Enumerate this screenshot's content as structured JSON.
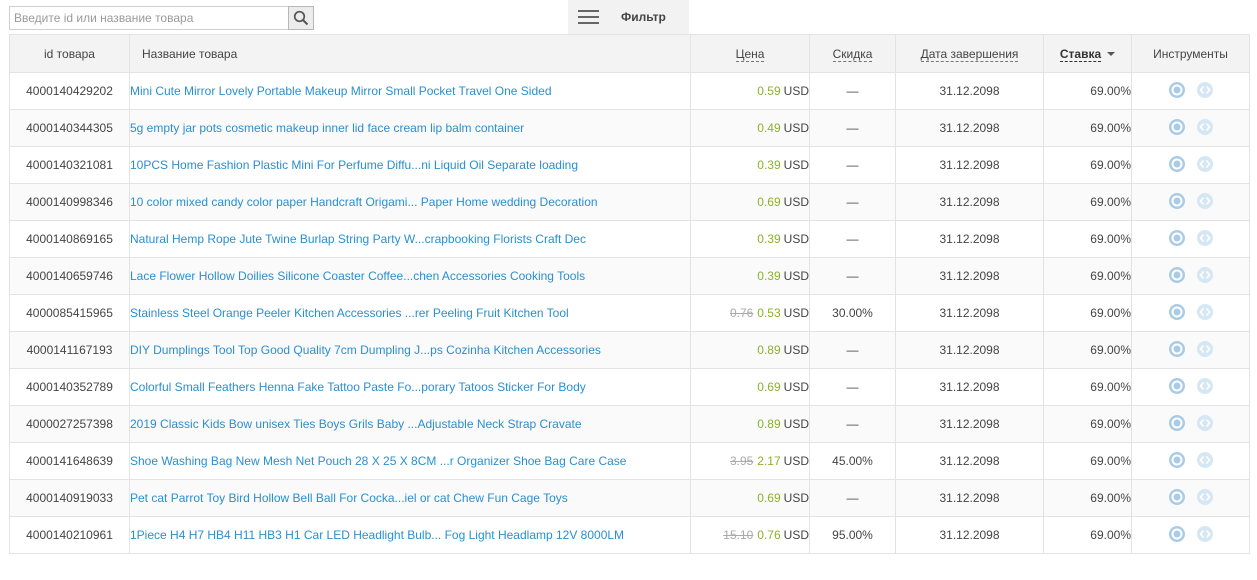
{
  "search": {
    "placeholder": "Введите id или название товара",
    "value": "",
    "icon": "search-icon"
  },
  "filter": {
    "label": "Фильтр",
    "icon": "hamburger-icon"
  },
  "table": {
    "headers": {
      "id": "id товара",
      "name": "Название товара",
      "price": "Цена",
      "discount": "Скидка",
      "end_date": "Дата завершения",
      "rate": "Ставка",
      "tools": "Инструменты"
    },
    "sorted_by": "rate",
    "sort_direction": "desc",
    "rows": [
      {
        "id": "4000140429202",
        "name": "Mini Cute Mirror Lovely Portable Makeup Mirror Small Pocket Travel One Sided",
        "old_price": "",
        "price": "0.59",
        "currency": "USD",
        "discount": "—",
        "end_date": "31.12.2098",
        "rate": "69.00%"
      },
      {
        "id": "4000140344305",
        "name": "5g empty jar pots cosmetic makeup inner lid face cream lip balm container",
        "old_price": "",
        "price": "0.49",
        "currency": "USD",
        "discount": "—",
        "end_date": "31.12.2098",
        "rate": "69.00%"
      },
      {
        "id": "4000140321081",
        "name": "10PCS Home Fashion Plastic Mini For Perfume Diffu...ni Liquid Oil Separate loading",
        "old_price": "",
        "price": "0.39",
        "currency": "USD",
        "discount": "—",
        "end_date": "31.12.2098",
        "rate": "69.00%"
      },
      {
        "id": "4000140998346",
        "name": "10 color mixed candy color paper Handcraft Origami... Paper Home wedding Decoration",
        "old_price": "",
        "price": "0.69",
        "currency": "USD",
        "discount": "—",
        "end_date": "31.12.2098",
        "rate": "69.00%"
      },
      {
        "id": "4000140869165",
        "name": "Natural Hemp Rope Jute Twine Burlap String Party W...crapbooking Florists Craft Dec",
        "old_price": "",
        "price": "0.39",
        "currency": "USD",
        "discount": "—",
        "end_date": "31.12.2098",
        "rate": "69.00%"
      },
      {
        "id": "4000140659746",
        "name": "Lace Flower Hollow Doilies Silicone Coaster Coffee...chen Accessories Cooking Tools",
        "old_price": "",
        "price": "0.39",
        "currency": "USD",
        "discount": "—",
        "end_date": "31.12.2098",
        "rate": "69.00%"
      },
      {
        "id": "4000085415965",
        "name": "Stainless Steel Orange Peeler Kitchen Accessories ...rer Peeling Fruit Kitchen Tool",
        "old_price": "0.76",
        "price": "0.53",
        "currency": "USD",
        "discount": "30.00%",
        "end_date": "31.12.2098",
        "rate": "69.00%"
      },
      {
        "id": "4000141167193",
        "name": "DIY Dumplings Tool Top Good Quality 7cm Dumpling J...ps Cozinha Kitchen Accessories",
        "old_price": "",
        "price": "0.89",
        "currency": "USD",
        "discount": "—",
        "end_date": "31.12.2098",
        "rate": "69.00%"
      },
      {
        "id": "4000140352789",
        "name": "Colorful Small Feathers Henna Fake Tattoo Paste Fo...porary Tatoos Sticker For Body",
        "old_price": "",
        "price": "0.69",
        "currency": "USD",
        "discount": "—",
        "end_date": "31.12.2098",
        "rate": "69.00%"
      },
      {
        "id": "4000027257398",
        "name": "2019 Classic Kids Bow unisex Ties Boys Grils Baby ...Adjustable Neck Strap Cravate",
        "old_price": "",
        "price": "0.89",
        "currency": "USD",
        "discount": "—",
        "end_date": "31.12.2098",
        "rate": "69.00%"
      },
      {
        "id": "4000141648639",
        "name": "Shoe Washing Bag New Mesh Net Pouch 28 X 25 X 8CM ...r Organizer Shoe Bag Care Case",
        "old_price": "3.95",
        "price": "2.17",
        "currency": "USD",
        "discount": "45.00%",
        "end_date": "31.12.2098",
        "rate": "69.00%"
      },
      {
        "id": "4000140919033",
        "name": "Pet cat Parrot Toy Bird Hollow Bell Ball For Cocka...iel or cat Chew Fun Cage Toys",
        "old_price": "",
        "price": "0.69",
        "currency": "USD",
        "discount": "—",
        "end_date": "31.12.2098",
        "rate": "69.00%"
      },
      {
        "id": "4000140210961",
        "name": "1Piece H4 H7 HB4 H11 HB3 H1 Car LED Headlight Bulb... Fog Light Headlamp 12V 8000LM",
        "old_price": "15.10",
        "price": "0.76",
        "currency": "USD",
        "discount": "95.00%",
        "end_date": "31.12.2098",
        "rate": "69.00%"
      }
    ]
  },
  "colors": {
    "link": "#2a8fd0",
    "price": "#8bb229",
    "tool_icon": "#a9cbe6",
    "tool_icon_faded": "#d6e7f4"
  }
}
